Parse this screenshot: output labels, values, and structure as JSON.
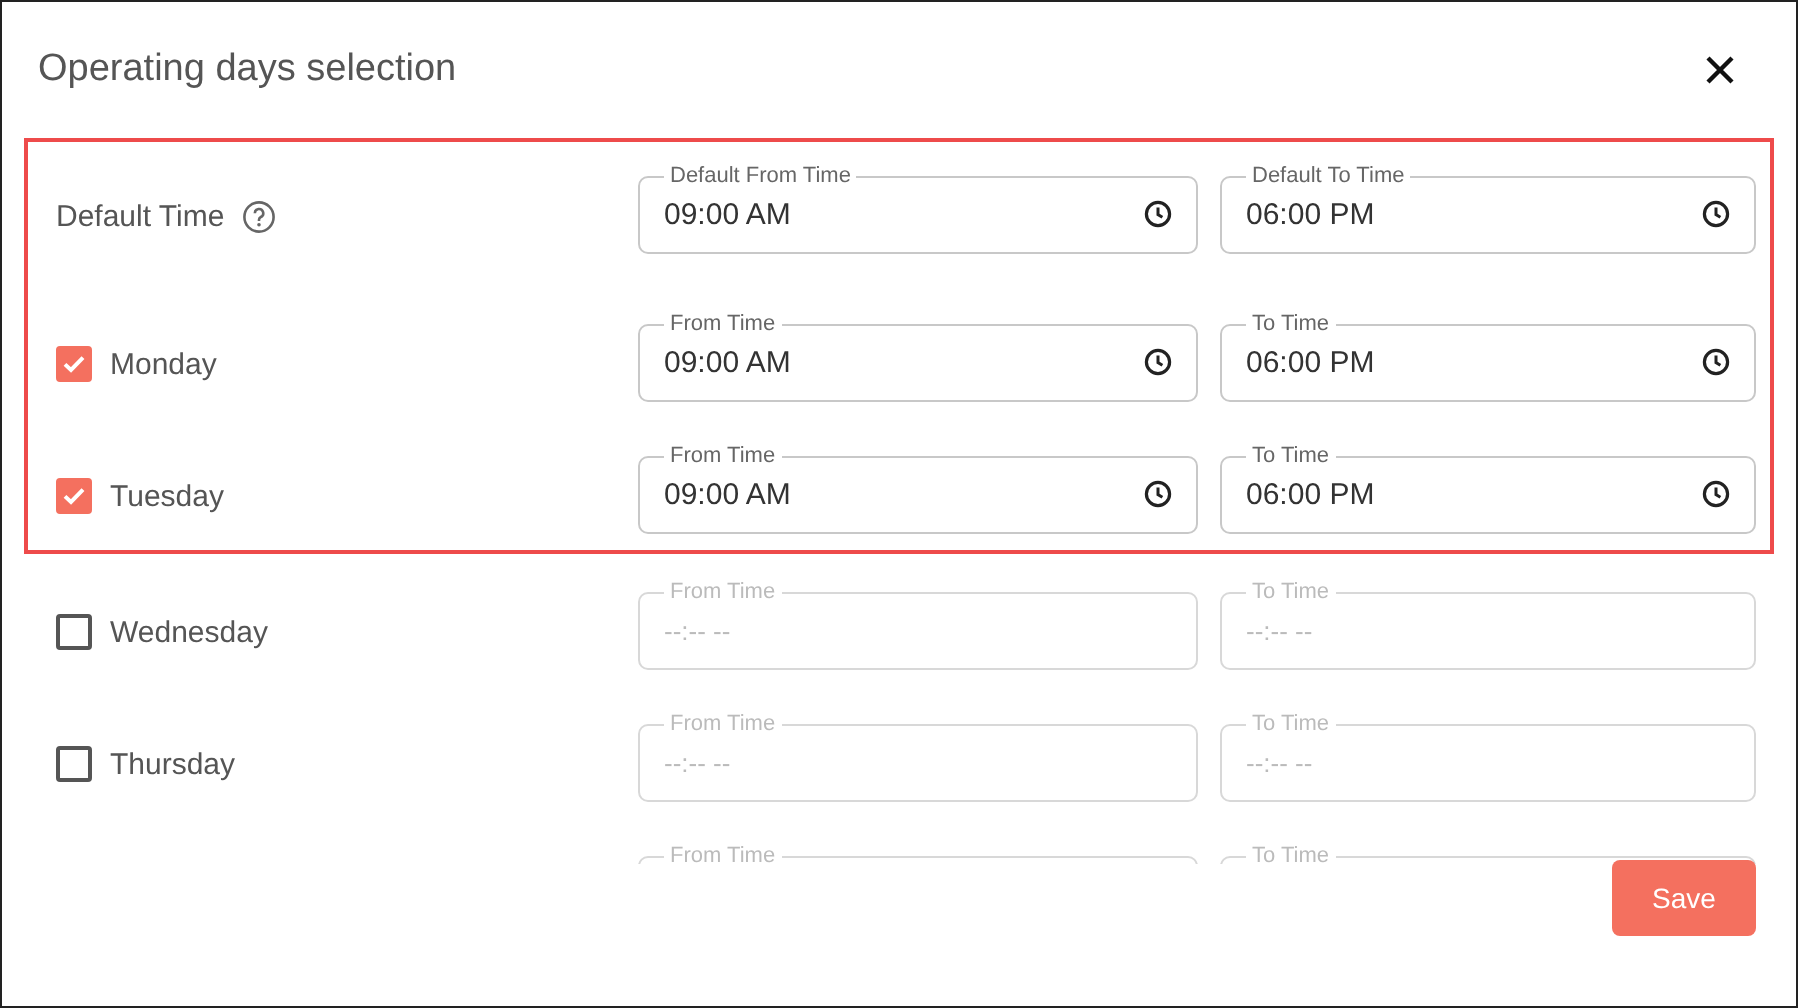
{
  "dialog": {
    "title": "Operating days selection"
  },
  "highlighted_rows": [
    {
      "kind": "default",
      "label": "Default Time",
      "from": {
        "label": "Default From Time",
        "value": "09:00 AM"
      },
      "to": {
        "label": "Default To Time",
        "value": "06:00 PM"
      }
    },
    {
      "kind": "day",
      "label": "Monday",
      "checked": true,
      "from": {
        "label": "From Time",
        "value": "09:00 AM"
      },
      "to": {
        "label": "To Time",
        "value": "06:00 PM"
      }
    },
    {
      "kind": "day",
      "label": "Tuesday",
      "checked": true,
      "from": {
        "label": "From Time",
        "value": "09:00 AM"
      },
      "to": {
        "label": "To Time",
        "value": "06:00 PM"
      }
    }
  ],
  "rows": [
    {
      "kind": "day",
      "label": "Wednesday",
      "checked": false,
      "from": {
        "label": "From Time",
        "placeholder": "--:-- --"
      },
      "to": {
        "label": "To Time",
        "placeholder": "--:-- --"
      }
    },
    {
      "kind": "day",
      "label": "Thursday",
      "checked": false,
      "from": {
        "label": "From Time",
        "placeholder": "--:-- --"
      },
      "to": {
        "label": "To Time",
        "placeholder": "--:-- --"
      }
    },
    {
      "kind": "cut",
      "from": {
        "label": "From Time"
      },
      "to": {
        "label": "To Time"
      }
    }
  ],
  "buttons": [
    {
      "label": "Save"
    }
  ]
}
